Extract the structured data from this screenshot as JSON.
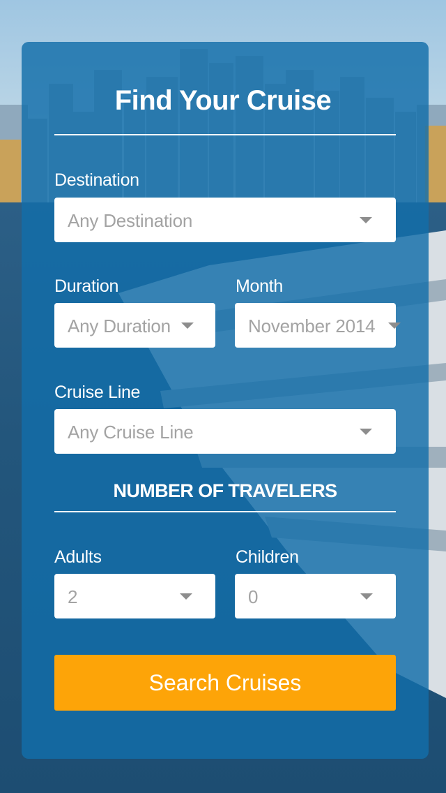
{
  "form": {
    "title": "Find Your Cruise",
    "destination": {
      "label": "Destination",
      "value": "Any Destination"
    },
    "duration": {
      "label": "Duration",
      "value": "Any Duration"
    },
    "month": {
      "label": "Month",
      "value": "November 2014"
    },
    "cruise_line": {
      "label": "Cruise Line",
      "value": "Any Cruise Line"
    },
    "travelers_heading": "NUMBER OF TRAVELERS",
    "adults": {
      "label": "Adults",
      "value": "2"
    },
    "children": {
      "label": "Children",
      "value": "0"
    },
    "search_label": "Search Cruises"
  },
  "colors": {
    "panel": "#126eaa",
    "button": "#fda408",
    "placeholder_text": "#a3a3a3"
  },
  "icons": {
    "select_caret": "chevron-down-icon"
  }
}
